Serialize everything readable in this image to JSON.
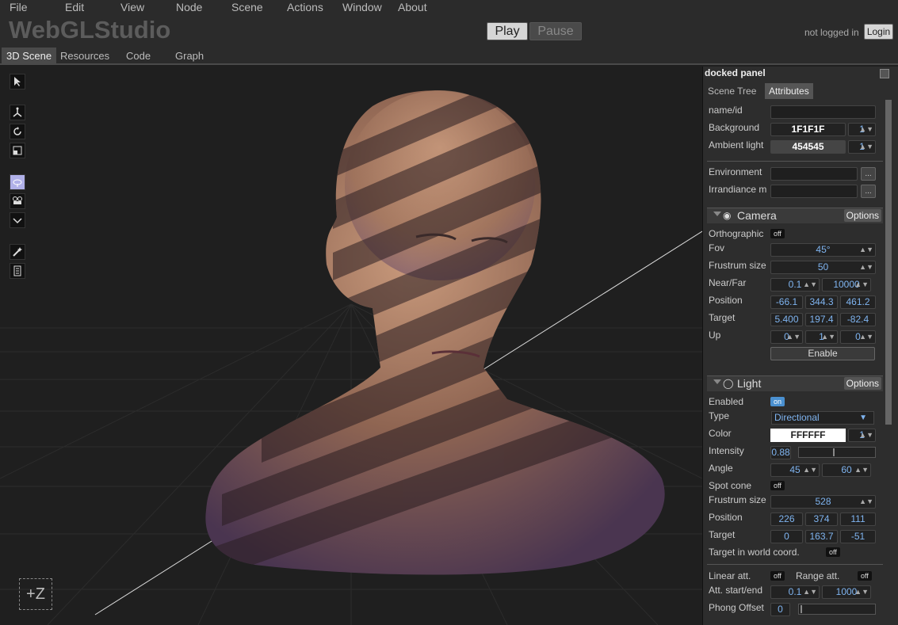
{
  "menu": [
    "File",
    "Edit",
    "View",
    "Node",
    "Scene",
    "Actions",
    "Window",
    "About"
  ],
  "header": {
    "title": "WebGLStudio",
    "play_label": "Play",
    "pause_label": "Pause",
    "login_status": "not logged in",
    "login_label": "Login"
  },
  "tabs": [
    "3D Scene",
    "Resources",
    "Code",
    "Graph"
  ],
  "viewport": {
    "axis_label": "+Z"
  },
  "panel": {
    "title": "docked panel",
    "tabs": [
      "Scene Tree",
      "Attributes"
    ],
    "scene": {
      "name_label": "name/id",
      "name_value": "",
      "background_label": "Background",
      "background_value": "1F1F1F",
      "background_alpha": "1",
      "ambient_label": "Ambient light",
      "ambient_value": "454545",
      "ambient_alpha": "1",
      "environment_label": "Environment",
      "environment_value": "",
      "irradiance_label": "Irrandiance m",
      "irradiance_value": "",
      "browse_label": "..."
    },
    "camera": {
      "title": "Camera",
      "options_label": "Options",
      "ortho_label": "Orthographic",
      "ortho_value": "off",
      "fov_label": "Fov",
      "fov_value": "45°",
      "frustum_label": "Frustrum size",
      "frustum_value": "50",
      "nearfar_label": "Near/Far",
      "near_value": "0.1",
      "far_value": "10000",
      "position_label": "Position",
      "position": [
        "-66.1",
        "344.3",
        "461.2"
      ],
      "target_label": "Target",
      "target": [
        "5.400",
        "197.4",
        "-82.4"
      ],
      "up_label": "Up",
      "up": [
        "0",
        "1",
        "0"
      ],
      "enable_label": "Enable"
    },
    "light": {
      "title": "Light",
      "options_label": "Options",
      "enabled_label": "Enabled",
      "enabled_value": "on",
      "type_label": "Type",
      "type_value": "Directional",
      "color_label": "Color",
      "color_value": "FFFFFF",
      "color_alpha": "1",
      "intensity_label": "Intensity",
      "intensity_value": "0.88",
      "angle_label": "Angle",
      "angle": [
        "45",
        "60"
      ],
      "spot_label": "Spot cone",
      "spot_value": "off",
      "frustum_label": "Frustrum size",
      "frustum_value": "528",
      "position_label": "Position",
      "position": [
        "226",
        "374",
        "111"
      ],
      "target_label": "Target",
      "target": [
        "0",
        "163.7",
        "-51"
      ],
      "world_label": "Target in world coord.",
      "world_value": "off",
      "linear_label": "Linear att.",
      "linear_value": "off",
      "range_label": "Range att.",
      "range_value": "off",
      "att_label": "Att. start/end",
      "att": [
        "0.1",
        "1000"
      ],
      "phong_label": "Phong Offset",
      "phong_value": "0"
    }
  },
  "colors": {
    "accent": "#4a90d0",
    "value_text": "#7fb4f0"
  }
}
